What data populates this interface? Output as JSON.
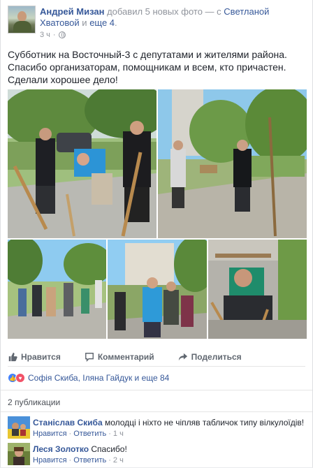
{
  "post": {
    "author": "Андрей Мизан",
    "action": "добавил 5 новых фото — с",
    "tagged1": "Светланой Хватовой",
    "and_text": "и",
    "tagged_more": "еще 4",
    "time": "3 ч",
    "separator": "·",
    "text": "Субботник на Восточный-3 с депутатами и жителями района. Спасибо организаторам, помощникам и всем, кто причастен. Сделали хорошее дело!"
  },
  "actions": {
    "like": "Нравится",
    "comment": "Комментарий",
    "share": "Поделиться"
  },
  "reactions": {
    "summary": "Софія Скиба, Іляна Гайдук и еще 84"
  },
  "shares": {
    "count_text": "2 публикации"
  },
  "comments": [
    {
      "name": "Станіслав Скиба",
      "text": "молодці і ніхто не чіпляв табличок типу вілкулоїдів!",
      "like": "Нравится",
      "reply": "Ответить",
      "sep": "·",
      "time": "1 ч"
    },
    {
      "name": "Леся Золотко",
      "text": "Спасибо!",
      "like": "Нравится",
      "reply": "Ответить",
      "sep": "·",
      "time": "2 ч"
    }
  ],
  "colors": {
    "link": "#365899",
    "meta": "#90949c",
    "like_reaction": "#4080ff",
    "love_reaction": "#f25268"
  }
}
